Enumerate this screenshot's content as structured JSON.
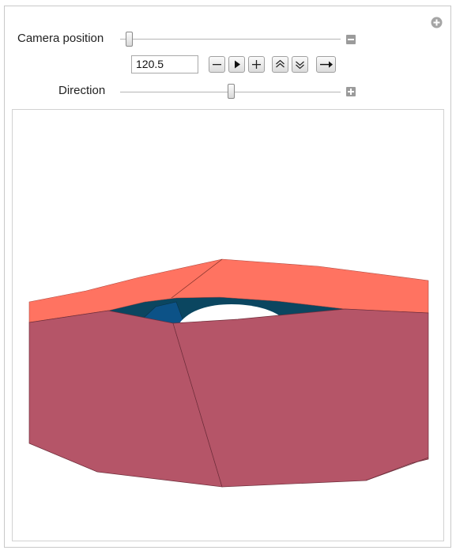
{
  "controls": {
    "camera_position": {
      "label": "Camera position",
      "value": "120.5"
    },
    "direction": {
      "label": "Direction"
    }
  },
  "icons": {
    "corner": "plus-circle-icon",
    "camera_toggle": "minus-box-icon",
    "direction_toggle": "plus-box-icon",
    "animation": [
      "minus-icon",
      "play-icon",
      "plus-icon",
      "faster-icon",
      "slower-icon",
      "direction-arrow-icon"
    ]
  },
  "colors": {
    "top_surface": "#ff7361",
    "side_surface": "#b55568",
    "inner_surface": "#0b4660",
    "inner_blue": "#0c5287"
  }
}
